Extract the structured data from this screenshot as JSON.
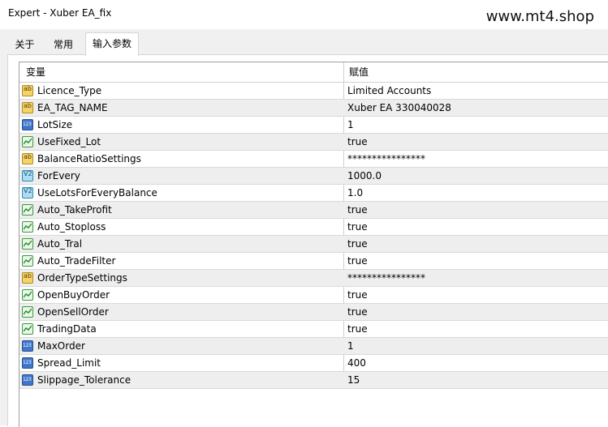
{
  "window": {
    "title": "Expert - Xuber EA_fix",
    "watermark": "www.mt4.shop"
  },
  "tabs": [
    {
      "label": "关于"
    },
    {
      "label": "常用"
    },
    {
      "label": "输入参数",
      "active": true
    }
  ],
  "table": {
    "headers": {
      "variable": "变量",
      "value": "赋值"
    },
    "rows": [
      {
        "icon": "ab",
        "name": "Licence_Type",
        "value": "Limited Accounts"
      },
      {
        "icon": "ab",
        "name": "EA_TAG_NAME",
        "value": "Xuber EA 330040028"
      },
      {
        "icon": "num",
        "name": "LotSize",
        "value": "1"
      },
      {
        "icon": "bool",
        "name": "UseFixed_Lot",
        "value": "true"
      },
      {
        "icon": "ab",
        "name": "BalanceRatioSettings",
        "value": "****************"
      },
      {
        "icon": "dbl",
        "name": "ForEvery",
        "value": "1000.0"
      },
      {
        "icon": "dbl",
        "name": "UseLotsForEveryBalance",
        "value": "1.0"
      },
      {
        "icon": "bool",
        "name": "Auto_TakeProfit",
        "value": "true"
      },
      {
        "icon": "bool",
        "name": "Auto_Stoploss",
        "value": "true"
      },
      {
        "icon": "bool",
        "name": "Auto_Tral",
        "value": "true"
      },
      {
        "icon": "bool",
        "name": "Auto_TradeFilter",
        "value": "true"
      },
      {
        "icon": "ab",
        "name": "OrderTypeSettings",
        "value": "****************"
      },
      {
        "icon": "bool",
        "name": "OpenBuyOrder",
        "value": "true"
      },
      {
        "icon": "bool",
        "name": "OpenSellOrder",
        "value": "true"
      },
      {
        "icon": "bool",
        "name": "TradingData",
        "value": "true"
      },
      {
        "icon": "num",
        "name": "MaxOrder",
        "value": "1"
      },
      {
        "icon": "num",
        "name": "Spread_Limit",
        "value": "400"
      },
      {
        "icon": "num",
        "name": "Slippage_Tolerance",
        "value": "15"
      }
    ]
  }
}
